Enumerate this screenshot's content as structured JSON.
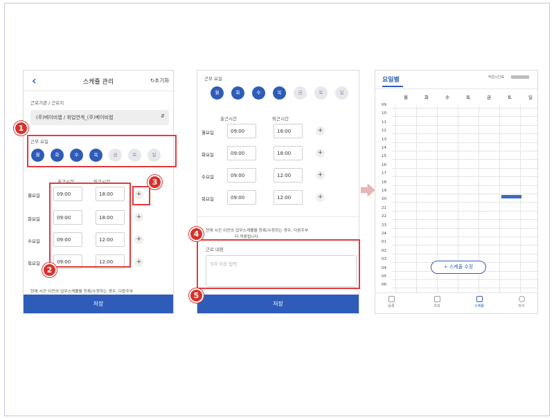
{
  "screen1": {
    "title": "스케쥴 관리",
    "reset_label": "초기화",
    "workplace_label": "근로기관 / 근로지",
    "workplace_value": "(주)베이비랩 / 취업연계_(주)베이비랩",
    "workdays_label": "근무 요일",
    "days": [
      {
        "label": "월",
        "selected": true
      },
      {
        "label": "화",
        "selected": true
      },
      {
        "label": "수",
        "selected": true
      },
      {
        "label": "목",
        "selected": true
      },
      {
        "label": "금",
        "selected": false
      },
      {
        "label": "토",
        "selected": false
      },
      {
        "label": "일",
        "selected": false
      }
    ],
    "start_header": "출근시간",
    "end_header": "퇴근시간",
    "rows": [
      {
        "day": "월요일",
        "start": "09:00",
        "end": "18:00"
      },
      {
        "day": "화요일",
        "start": "09:00",
        "end": "18:00"
      },
      {
        "day": "수요일",
        "start": "09:00",
        "end": "12:00"
      },
      {
        "day": "목요일",
        "start": "09:00",
        "end": "12:00"
      }
    ],
    "notice": "현재 시간 이전의 업무스케쥴을 등록/수정하는 경우, 다음주부",
    "save_label": "저장"
  },
  "screen2": {
    "workdays_label": "근무 요일",
    "days": [
      "월",
      "화",
      "수",
      "목",
      "금",
      "토",
      "일"
    ],
    "start_header": "출근시간",
    "end_header": "퇴근시간",
    "rows": [
      {
        "day": "월요일",
        "start": "09:00",
        "end": "18:00"
      },
      {
        "day": "화요일",
        "start": "09:00",
        "end": "18:00"
      },
      {
        "day": "수요일",
        "start": "09:00",
        "end": "12:00"
      },
      {
        "day": "목요일",
        "start": "09:00",
        "end": "12:00"
      }
    ],
    "notice": "현재 시간 이전의 업무스케쥴을 등록/수정하는 경우, 다음주부",
    "notice2": "터 적용됩니다.",
    "memo_label": "근로 내용",
    "memo_placeholder": "5자 이상 입력",
    "save_label": "저장"
  },
  "screen3": {
    "title": "요일별",
    "work_hours_label": "작업시간표",
    "days": [
      "월",
      "화",
      "수",
      "목",
      "금",
      "토",
      "일"
    ],
    "hours": [
      "09",
      "10",
      "11",
      "12",
      "13",
      "14",
      "15",
      "16",
      "17",
      "18",
      "19",
      "20",
      "21",
      "22",
      "23",
      "24",
      "01",
      "02",
      "03",
      "04",
      "05",
      "06"
    ],
    "edit_button": "+ 스케쥴 수정",
    "tabs": [
      "등록",
      "조회",
      "스케쥴",
      "마이"
    ]
  },
  "badges": [
    "1",
    "2",
    "3",
    "4",
    "5"
  ],
  "colors": {
    "primary": "#2f5cb8",
    "annotation": "#e03a3a",
    "badge": "#d8322c"
  }
}
